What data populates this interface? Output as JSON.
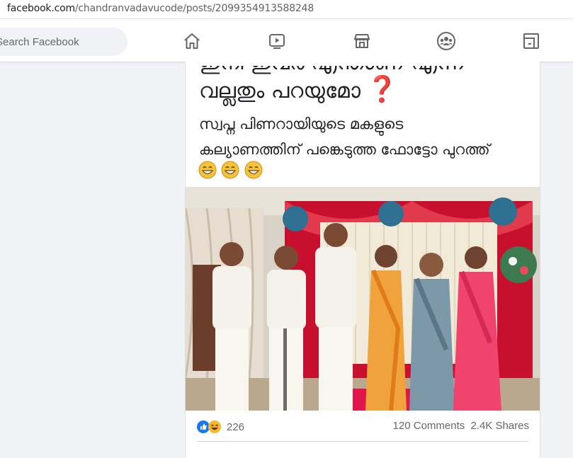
{
  "browser": {
    "url_host": "facebook.com",
    "url_path": "/chandranvadavucode/posts/2099354913588248"
  },
  "header": {
    "search_placeholder": "Search Facebook",
    "nav_icons": [
      "home-icon",
      "watch-icon",
      "marketplace-icon",
      "groups-icon",
      "gaming-icon"
    ]
  },
  "post": {
    "text_line0": "ഇനി ഇവർ എന്താണ് എന്ന",
    "text_line1": "വല്ലതും പറയുമോ",
    "question_mark": "❓",
    "text_line2": "സ്വപ്ന പിണറായിയുടെ മകളുടെ",
    "text_line3": "കല്യാണത്തിന് പങ്കെടുത്ത ഫോട്ടോ പുറത്ത്",
    "emoji_count": 3,
    "reaction_count": "226",
    "comments": "120 Comments",
    "shares": "2.4K Shares",
    "colors": {
      "like_blue": "#1877f2",
      "haha_yellow": "#f7b928",
      "question_red": "#e53935"
    }
  }
}
